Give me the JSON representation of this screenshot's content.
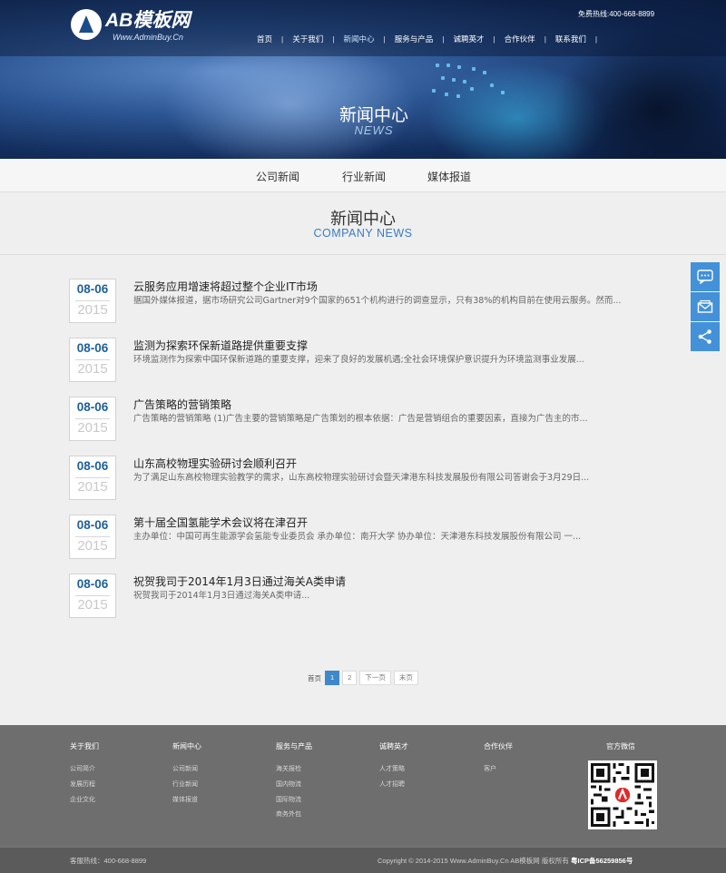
{
  "header": {
    "logo_main": "AB模板网",
    "logo_sub": "Www.AdminBuy.Cn",
    "hotline": "免费热线:400-668-8899",
    "nav": [
      "首页",
      "关于我们",
      "新闻中心",
      "服务与产品",
      "诚聘英才",
      "合作伙伴",
      "联系我们"
    ],
    "active_nav": "新闻中心"
  },
  "banner": {
    "title": "新闻中心",
    "subtitle": "NEWS"
  },
  "subnav": [
    "公司新闻",
    "行业新闻",
    "媒体报道"
  ],
  "section": {
    "title": "新闻中心",
    "subtitle": "COMPANY NEWS"
  },
  "news": [
    {
      "month_day": "08-06",
      "year": "2015",
      "title": "云服务应用增速将超过整个企业IT市场",
      "desc": "据国外媒体报道，据市场研究公司Gartner对9个国家的651个机构进行的调查显示，只有38%的机构目前在使用云服务。然而..."
    },
    {
      "month_day": "08-06",
      "year": "2015",
      "title": "监测为探索环保新道路提供重要支撑",
      "desc": "环境监测作为探索中国环保新道路的重要支撑，迎来了良好的发展机遇;全社会环境保护意识提升为环境监测事业发展..."
    },
    {
      "month_day": "08-06",
      "year": "2015",
      "title": "广告策略的营销策略",
      "desc": "广告策略的营销策略 (1)广告主要的营销策略是广告策划的根本依据：广告是营销组合的重要因素，直接为广告主的市..."
    },
    {
      "month_day": "08-06",
      "year": "2015",
      "title": "山东高校物理实验研讨会顺利召开",
      "desc": "为了满足山东高校物理实验教学的需求，山东高校物理实验研讨会暨天津港东科技发展股份有限公司答谢会于3月29日..."
    },
    {
      "month_day": "08-06",
      "year": "2015",
      "title": "第十届全国氢能学术会议将在津召开",
      "desc": "主办单位：中国可再生能源学会氢能专业委员会 承办单位：南开大学 协办单位：天津港东科技发展股份有限公司 一..."
    },
    {
      "month_day": "08-06",
      "year": "2015",
      "title": "祝贺我司于2014年1月3日通过海关A类申请",
      "desc": "祝贺我司于2014年1月3日通过海关A类申请..."
    }
  ],
  "pagination": {
    "first": "首页",
    "pages": [
      "1",
      "2"
    ],
    "current": "1",
    "next": "下一页",
    "last": "末页"
  },
  "side_icons": [
    "chat-icon",
    "mail-icon",
    "share-icon"
  ],
  "footer": {
    "columns": [
      {
        "heading": "关于我们",
        "links": [
          "公司简介",
          "发展历程",
          "企业文化"
        ]
      },
      {
        "heading": "新闻中心",
        "links": [
          "公司新闻",
          "行业新闻",
          "媒体报道"
        ]
      },
      {
        "heading": "服务与产品",
        "links": [
          "海关报检",
          "国内物流",
          "国际物流",
          "商务外包"
        ]
      },
      {
        "heading": "诚聘英才",
        "links": [
          "人才策略",
          "人才招聘"
        ]
      },
      {
        "heading": "合作伙伴",
        "links": [
          "客户"
        ]
      }
    ],
    "qr_heading": "官方微信",
    "hotline": "客服热线：400-668-8899",
    "copyright": "Copyright © 2014-2015 Www.AdminBuy.Cn AB模板网 版权所有",
    "icp": "粤ICP备56259856号"
  },
  "colors": {
    "accent": "#3e88cc",
    "date_text": "#1e5f9a",
    "footer_bg": "#6e6e6e"
  }
}
